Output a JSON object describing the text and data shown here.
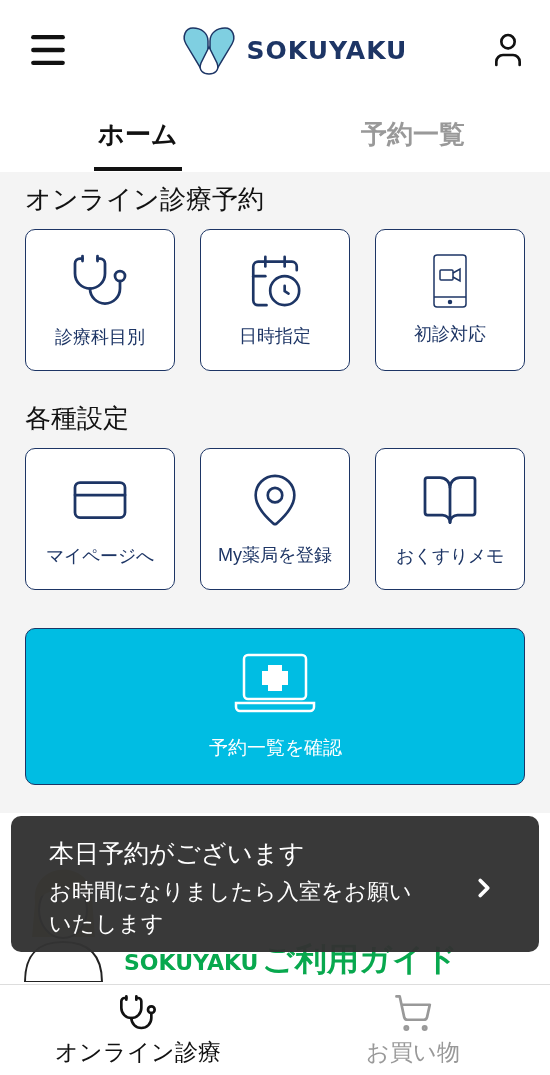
{
  "header": {
    "logo_text": "SOKUYAKU"
  },
  "tabs": [
    {
      "label": "ホーム",
      "selected": true
    },
    {
      "label": "予約一覧",
      "selected": false
    }
  ],
  "sections": [
    {
      "title": "オンライン診療予約",
      "tiles": [
        {
          "label": "診療科目別"
        },
        {
          "label": "日時指定"
        },
        {
          "label": "初診対応"
        }
      ]
    },
    {
      "title": "各種設定",
      "tiles": [
        {
          "label": "マイページへ"
        },
        {
          "label": "My薬局を登録"
        },
        {
          "label": "おくすりメモ"
        }
      ]
    }
  ],
  "main_button": {
    "label": "予約一覧を確認"
  },
  "banner": {
    "brand": "SOKUYAKU",
    "title": "ご利用ガイド"
  },
  "toast": {
    "title": "本日予約がございます",
    "message": "お時間になりましたら入室をお願いいたします"
  },
  "bottom_nav": [
    {
      "label": "オンライン診療",
      "selected": true
    },
    {
      "label": "お買い物",
      "selected": false
    }
  ]
}
